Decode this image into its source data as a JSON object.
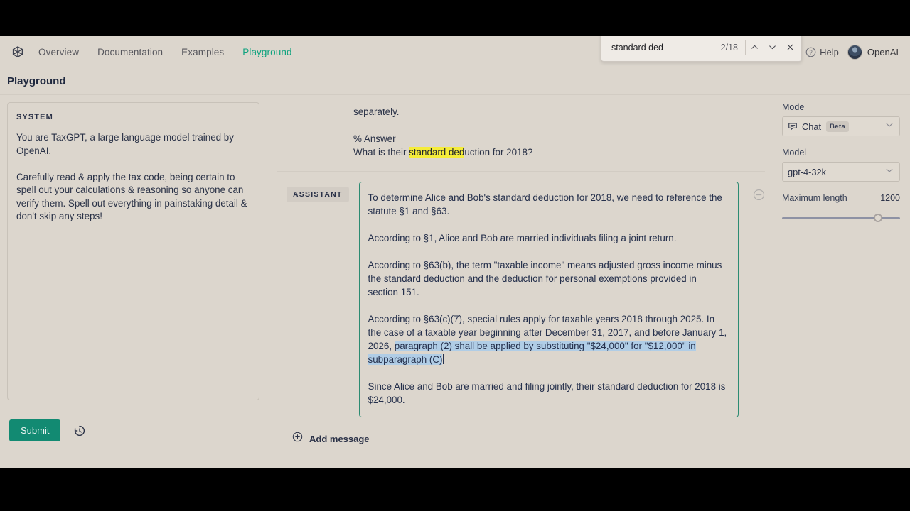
{
  "colors": {
    "page_bg": "#dcd6cd",
    "accent_teal": "#10a37f",
    "submit_bg": "#128a72",
    "find_highlight": "#f5ec3a",
    "selection_highlight": "#b0cde6",
    "text_primary": "#2a3247",
    "focus_border": "#2c8b72"
  },
  "browser_find": {
    "query": "standard ded",
    "placeholder": "Find in page",
    "match_count": "2/18",
    "prev_icon": "chevron-up-icon",
    "next_icon": "chevron-down-icon",
    "close_icon": "close-icon"
  },
  "topnav": {
    "logo_icon": "openai-logo-icon",
    "links": [
      {
        "label": "Overview",
        "active": false
      },
      {
        "label": "Documentation",
        "active": false
      },
      {
        "label": "Examples",
        "active": false
      },
      {
        "label": "Playground",
        "active": true
      }
    ],
    "help_label": "Help",
    "help_icon": "question-circle-icon",
    "account_label": "OpenAI",
    "avatar_icon": "user-avatar"
  },
  "page": {
    "title": "Playground"
  },
  "system_panel": {
    "label": "SYSTEM",
    "text": "You are TaxGPT, a large language model trained by OpenAI.\n\nCarefully read & apply the tax code, being certain to spell out your calculations & reasoning so anyone can verify them. Spell out everything in painstaking detail & don't skip any steps!"
  },
  "left_actions": {
    "submit_label": "Submit",
    "history_icon": "history-clock-icon"
  },
  "chat": {
    "previous_message_tail": {
      "line1": "separately.",
      "line2": "% Answer",
      "line3_before": "What is their ",
      "line3_match": "standard ded",
      "line3_after": "uction for 2018?"
    },
    "assistant": {
      "role_label": "ASSISTANT",
      "remove_icon": "minus-circle-icon",
      "paragraphs": [
        {
          "segments": [
            {
              "text": "To determine Alice and Bob's standard deduction for 2018, we need to reference the statute §1 and §63.",
              "selected": false
            }
          ]
        },
        {
          "segments": [
            {
              "text": "According to §1, Alice and Bob are married individuals filing a joint return.",
              "selected": false
            }
          ]
        },
        {
          "segments": [
            {
              "text": "According to §63(b), the term \"taxable income\" means adjusted gross income minus the standard deduction and the deduction for personal exemptions provided in section 151.",
              "selected": false
            }
          ]
        },
        {
          "segments": [
            {
              "text": "According to §63(c)(7), special rules apply for taxable years 2018 through 2025. In the case of a taxable year beginning after December 31, 2017, and before January 1, 2026, ",
              "selected": false
            },
            {
              "text": "paragraph (2) shall be applied by substituting \"$24,000\" for \"$12,000\" in subparagraph (C)",
              "selected": true
            }
          ]
        },
        {
          "segments": [
            {
              "text": "Since Alice and Bob are married and filing jointly, their standard deduction for 2018 is $24,000.",
              "selected": false
            }
          ]
        }
      ]
    },
    "add_message": {
      "label": "Add message",
      "icon": "plus-circle-icon"
    }
  },
  "sidebar": {
    "mode": {
      "label": "Mode",
      "value": "Chat",
      "badge": "Beta",
      "icon": "chat-bubble-icon",
      "chevron": "chevron-down-icon"
    },
    "model": {
      "label": "Model",
      "value": "gpt-4-32k",
      "chevron": "chevron-down-icon"
    },
    "maximum_length": {
      "label": "Maximum length",
      "value": "1200",
      "slider_percent": 78
    }
  }
}
